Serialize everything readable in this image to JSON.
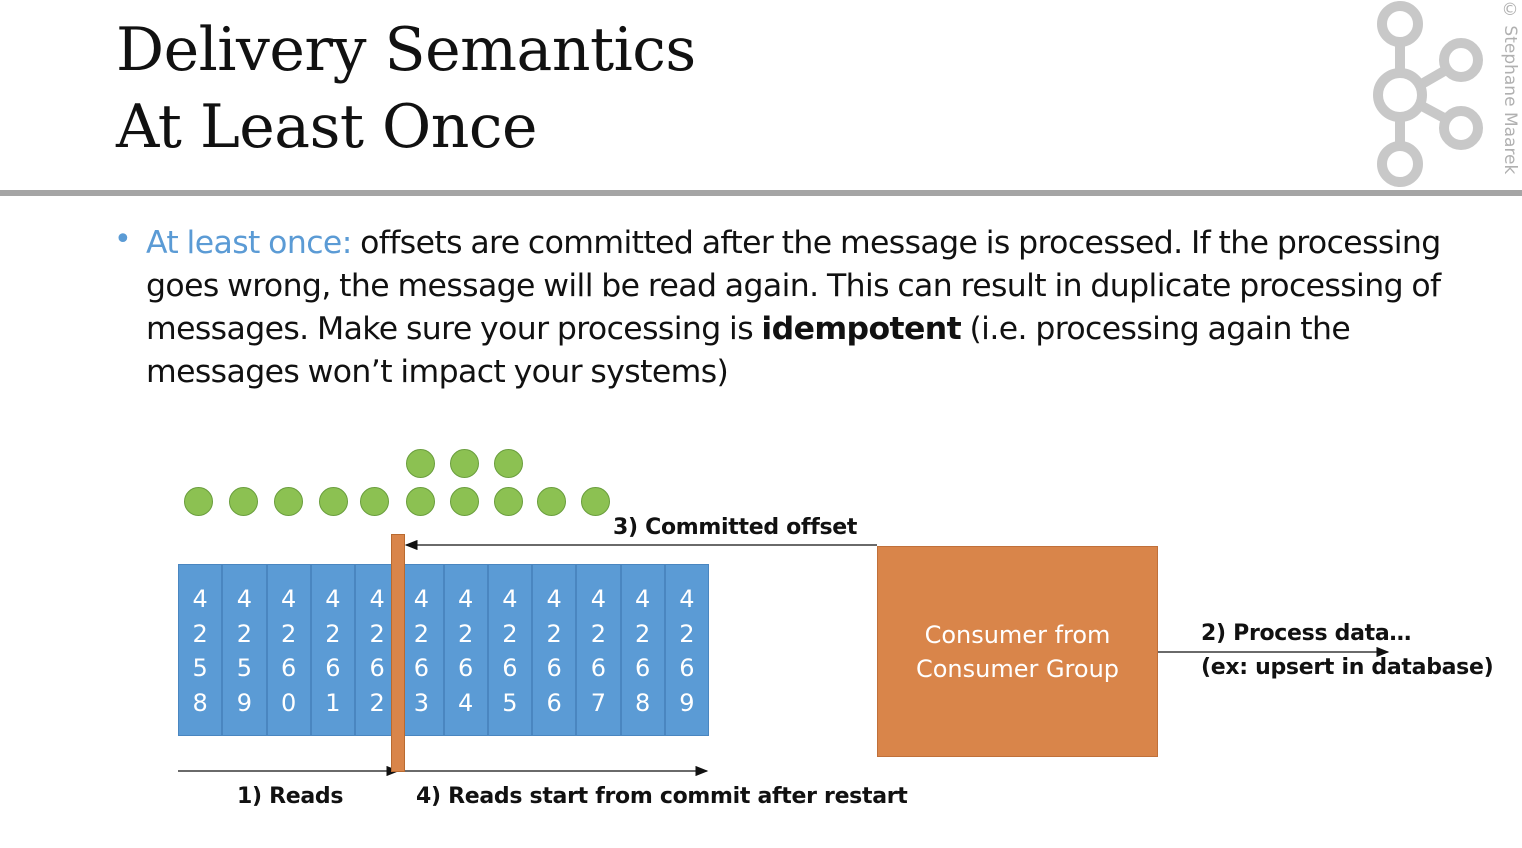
{
  "slide": {
    "title_line1": "Delivery Semantics",
    "title_line2": "At Least Once",
    "copyright": "© Stephane Maarek",
    "logo_icon": "kafka-logo-icon"
  },
  "bullet": {
    "marker": "•",
    "highlight": "At least once:",
    "text1": " offsets are committed after the message is processed. If the processing goes wrong, the message will be read again. This can result in duplicate processing of messages. Make sure your processing is ",
    "bold": "idempotent",
    "text2": " (i.e. processing again the messages won’t impact your systems)"
  },
  "diagram": {
    "offsets": [
      "4258",
      "4259",
      "4260",
      "4261",
      "4262",
      "4263",
      "4264",
      "4265",
      "4266",
      "4267",
      "4268",
      "4269"
    ],
    "messages_read_first": 10,
    "messages_reprocessed": 3,
    "consumer_line1": "Consumer from",
    "consumer_line2": "Consumer Group",
    "label_committed": "3) Committed offset",
    "label_process1": "2) Process data…",
    "label_process2": "(ex: upsert in database)",
    "label_reads": "1) Reads",
    "label_restart": "4) Reads start from commit after restart",
    "colors": {
      "partition": "#5b9bd5",
      "consumer": "#d9854a",
      "message": "#8cc152",
      "accent": "#5b9bd5"
    }
  }
}
